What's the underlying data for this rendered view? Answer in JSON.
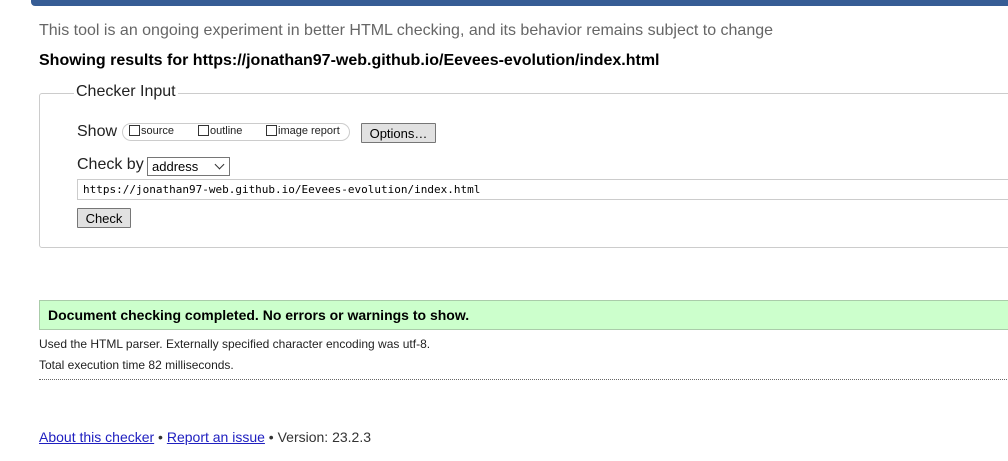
{
  "page": {
    "tagline": "This tool is an ongoing experiment in better HTML checking, and its behavior remains subject to change",
    "results_heading": "Showing results for https://jonathan97-web.github.io/Eevees-evolution/index.html"
  },
  "checker_input": {
    "legend": "Checker Input",
    "show_label": "Show",
    "options": [
      {
        "label": "source",
        "checked": false
      },
      {
        "label": "outline",
        "checked": false
      },
      {
        "label": "image report",
        "checked": false
      }
    ],
    "options_button": "Options…",
    "check_by_label": "Check by",
    "check_by_value": "address",
    "url_value": "https://jonathan97-web.github.io/Eevees-evolution/index.html",
    "check_button": "Check"
  },
  "results": {
    "success_message": "Document checking completed. No errors or warnings to show.",
    "parser_note": "Used the HTML parser. Externally specified character encoding was utf-8.",
    "time_note": "Total execution time 82 milliseconds."
  },
  "footer": {
    "about_link": "About this checker",
    "separator_1": " • ",
    "report_link": "Report an issue",
    "version_text": " • Version: 23.2.3"
  },
  "colors": {
    "top_bar": "#365d95",
    "success_bg": "#ccffcc",
    "link": "#2020c0"
  }
}
